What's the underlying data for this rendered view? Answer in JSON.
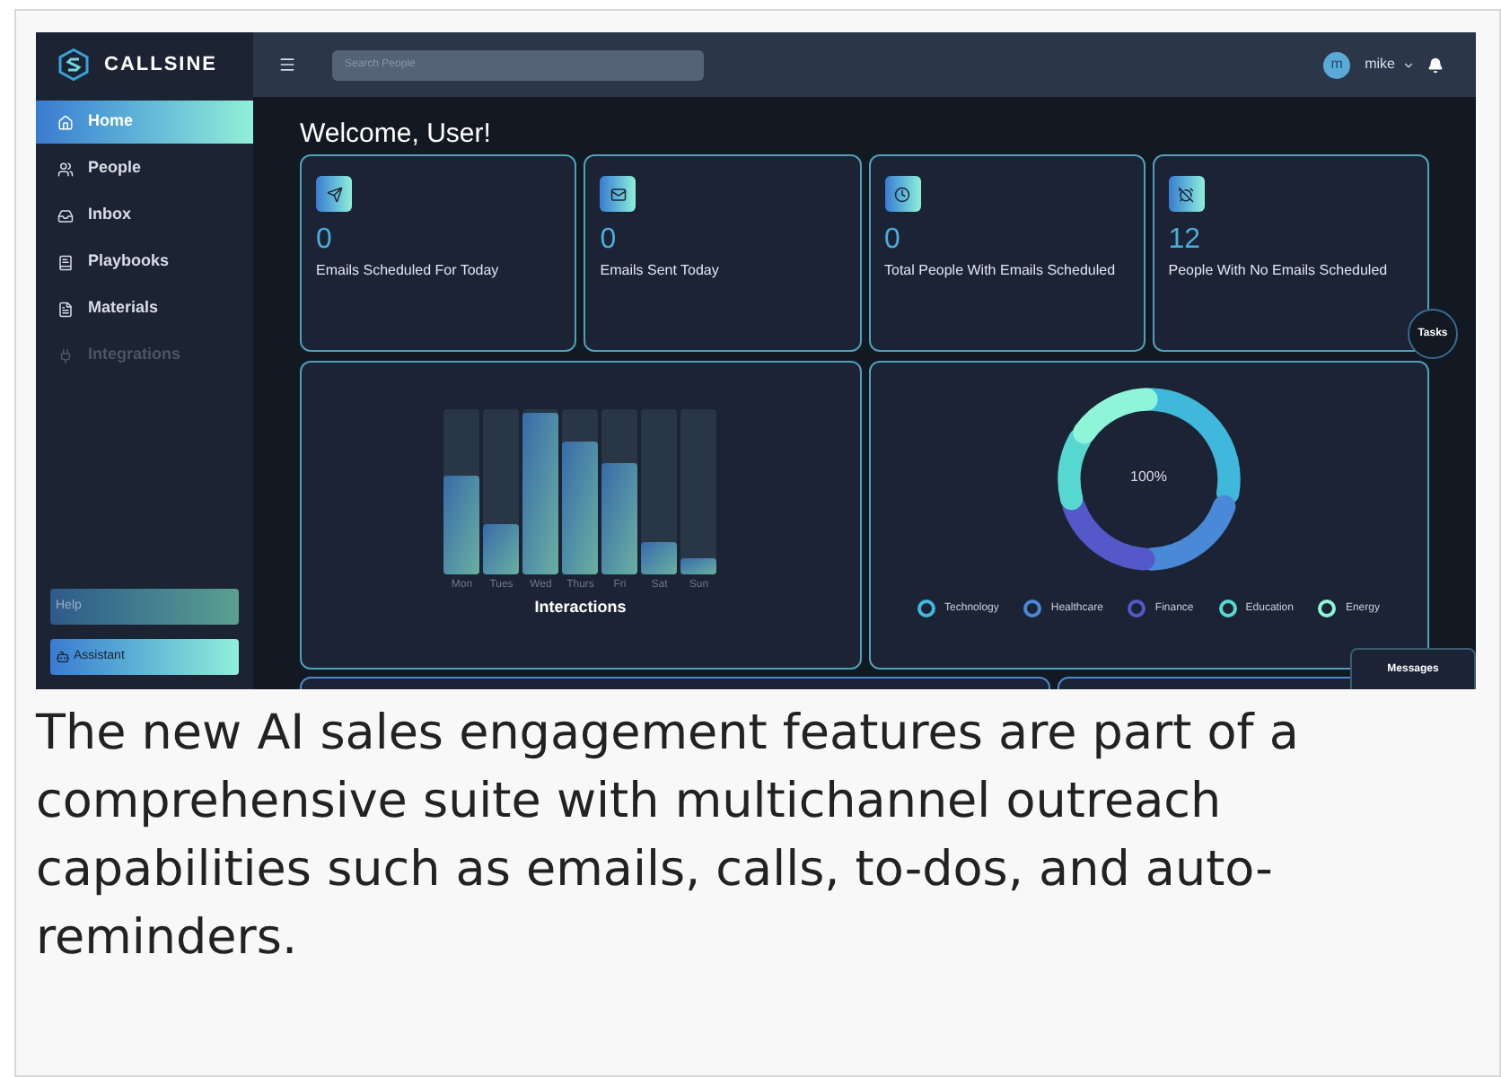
{
  "app": {
    "logo": "CALLSINE",
    "search": {
      "placeholder": "Search People"
    },
    "user": {
      "initial": "m",
      "name": "mike"
    },
    "sidebar": {
      "items": [
        {
          "label": "Home",
          "selected": true,
          "disabled": false
        },
        {
          "label": "People",
          "selected": false,
          "disabled": false
        },
        {
          "label": "Inbox",
          "selected": false,
          "disabled": false
        },
        {
          "label": "Playbooks",
          "selected": false,
          "disabled": false
        },
        {
          "label": "Materials",
          "selected": false,
          "disabled": false
        },
        {
          "label": "Integrations",
          "selected": false,
          "disabled": true
        }
      ],
      "buttons": [
        {
          "label": "Help",
          "kind": "plain"
        },
        {
          "label": "Assistant",
          "kind": "bot"
        }
      ]
    },
    "welcome": "Welcome, User!",
    "stats": [
      {
        "value": "0",
        "label": "Emails Scheduled For Today"
      },
      {
        "value": "0",
        "label": "Emails Sent Today"
      },
      {
        "value": "0",
        "label": "Total People With Emails Scheduled"
      },
      {
        "value": "12",
        "label": "People With No Emails Scheduled"
      }
    ],
    "interactions": {
      "title": "Interactions",
      "bars": [
        {
          "label": "Mon",
          "level": 0.6
        },
        {
          "label": "Tues",
          "level": 0.3
        },
        {
          "label": "Wed",
          "level": 0.98
        },
        {
          "label": "Thurs",
          "level": 0.8
        },
        {
          "label": "Fri",
          "level": 0.67
        },
        {
          "label": "Sat",
          "level": 0.2
        },
        {
          "label": "Sun",
          "level": 0.1
        }
      ]
    },
    "industries": {
      "center": "100%",
      "legend": [
        {
          "label": "Technology",
          "color": "#40b8dc"
        },
        {
          "label": "Healthcare",
          "color": "#4a88d8"
        },
        {
          "label": "Finance",
          "color": "#5558c8"
        },
        {
          "label": "Education",
          "color": "#56d8d0"
        },
        {
          "label": "Energy",
          "color": "#8ef5d8"
        }
      ]
    },
    "tasks_button": "Tasks",
    "messages_button": "Messages"
  },
  "caption": "The new AI sales engagement features are part of a comprehensive suite with multichannel outreach capabilities such as emails, calls, to-dos, and auto-reminders."
}
